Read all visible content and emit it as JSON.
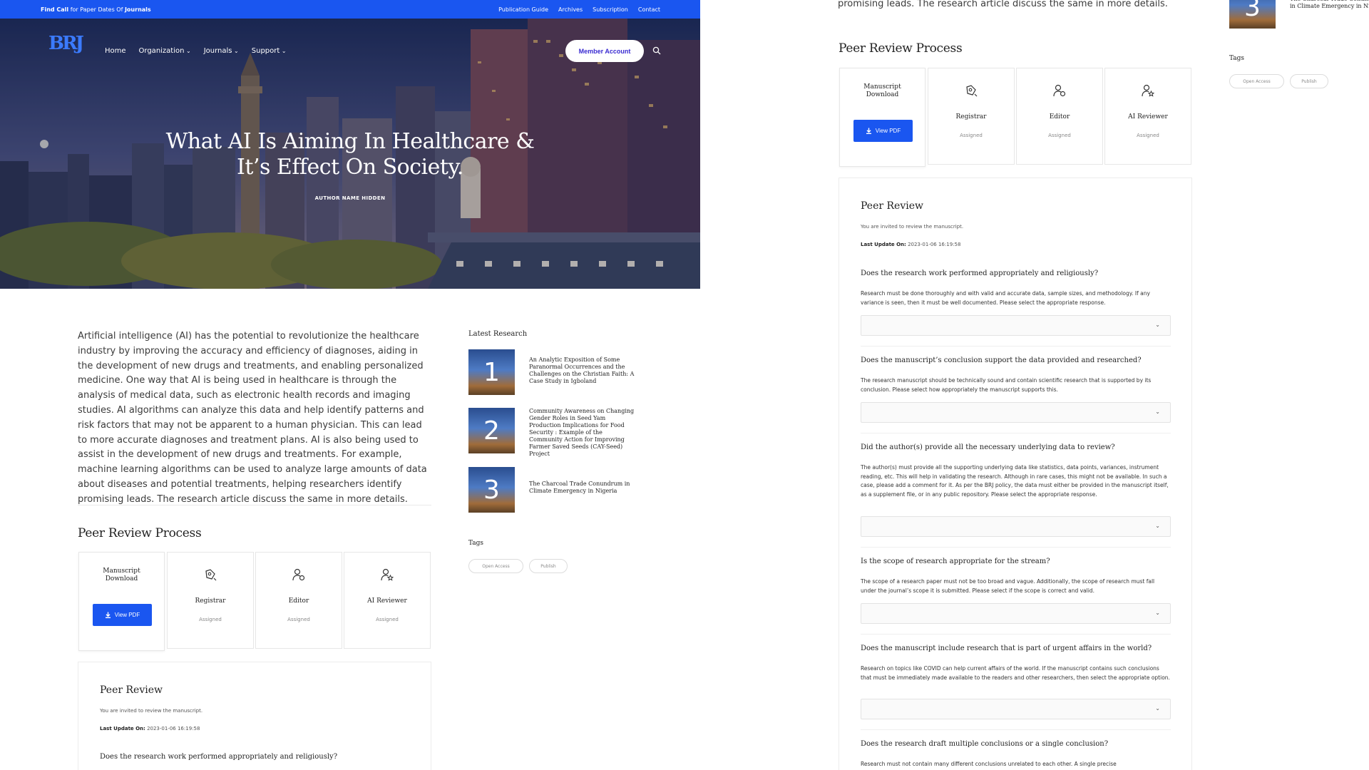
{
  "topbar": {
    "findcall_bold": "Find Call",
    "findcall_mid": " for Paper Dates Of ",
    "findcall_end": "Journals",
    "links": [
      "Publication Guide",
      "Archives",
      "Subscription",
      "Contact"
    ]
  },
  "nav": {
    "logo_text": "BRJ",
    "items": [
      "Home",
      "Organization",
      "Journals",
      "Support"
    ],
    "member_button": "Member Account",
    "search_icon": "search-icon"
  },
  "hero": {
    "title_line1": "What AI Is Aiming In Healthcare &",
    "title_line2": "It’s Effect On Society.",
    "author": "AUTHOR NAME HIDDEN"
  },
  "article": {
    "body": "Artificial intelligence (AI) has the potential to revolutionize the healthcare industry by improving the accuracy and efficiency of diagnoses, aiding in the development of new drugs and treatments, and enabling personalized medicine. One way that AI is being used in healthcare is through the analysis of medical data, such as electronic health records and imaging studies. AI algorithms can analyze this data and help identify patterns and risk factors that may not be apparent to a human physician. This can lead to more accurate diagnoses and treatment plans. AI is also being used to assist in the development of new drugs and treatments. For example, machine learning algorithms can be used to analyze large amounts of data about diseases and potential treatments, helping researchers identify promising leads. The research article discuss the same in more details.",
    "tail": "promising leads. The research article discuss the same in more details."
  },
  "sidebar": {
    "latest_title": "Latest Research",
    "items": [
      {
        "num": "1",
        "title": "An Analytic Exposition of Some Paranormal Occurrences and the Challenges on the Christian Faith: A Case Study in Igboland"
      },
      {
        "num": "2",
        "title": "Community Awareness on Changing Gender Roles in Seed Yam Production Implications for Food Security : Example of the Community Action for Improving Farmer Saved Seeds (CAY-Seed) Project"
      },
      {
        "num": "3",
        "title": "The Charcoal Trade Conundrum in Climate Emergency in Nigeria"
      }
    ],
    "tags_title": "Tags",
    "tags": [
      "Open Access",
      "Publish"
    ]
  },
  "process": {
    "title": "Peer Review Process",
    "cards": [
      {
        "title": "Manuscript Download",
        "button": "View PDF",
        "icon": "download-icon"
      },
      {
        "title": "Registrar",
        "status": "Assigned",
        "icon": "registrar-icon"
      },
      {
        "title": "Editor",
        "status": "Assigned",
        "icon": "editor-user-icon"
      },
      {
        "title": "AI Reviewer",
        "status": "Assigned",
        "icon": "reviewer-star-icon"
      }
    ]
  },
  "review": {
    "title": "Peer Review",
    "invite": "You are invited to review the manuscript.",
    "update_label": "Last Update On:",
    "update_value": "2023-01-06 16:19:58",
    "questions": [
      {
        "q": "Does the research work performed appropriately and religiously?",
        "desc": "Research must be done thoroughly and with valid and accurate data, sample sizes, and methodology. If any variance is seen, then it must be well documented. Please select the appropriate response."
      },
      {
        "q": "Does the manuscript’s conclusion support the data provided and researched?",
        "desc": "The research manuscript should be technically sound and contain scientific research that is supported by its conclusion. Please select how appropriately the manuscript supports this."
      },
      {
        "q": "Did the author(s) provide all the necessary underlying data to review?",
        "desc": "The author(s) must provide all the supporting underlying data like statistics, data points, variances, instrument reading, etc. This will help in validating the research. Although in rare cases, this might not be available. In such a case, please add a comment for it. As per the BRJ policy, the data must either be provided in the manuscript itself, as a supplement file, or in any public repository. Please select the appropriate response."
      },
      {
        "q": "Is the scope of research appropriate for the stream?",
        "desc": "The scope of a research paper must not be too broad and vague. Additionally, the scope of research must fall under the journal’s scope it is submitted. Please select if the scope is correct and valid."
      },
      {
        "q": "Does the manuscript include research that is part of urgent affairs in the world?",
        "desc": "Research on topics like COVID can help current affairs of the world. If the manuscript contains such conclusions that must be immediately made available to the readers and other researchers, then select the appropriate option."
      },
      {
        "q": "Does the research draft multiple conclusions or a single conclusion?",
        "desc": "Research must not contain many different conclusions unrelated to each other. A single precise"
      }
    ]
  },
  "colors": {
    "brand_blue": "#1a56f0",
    "member_text": "#3a2bd1"
  }
}
